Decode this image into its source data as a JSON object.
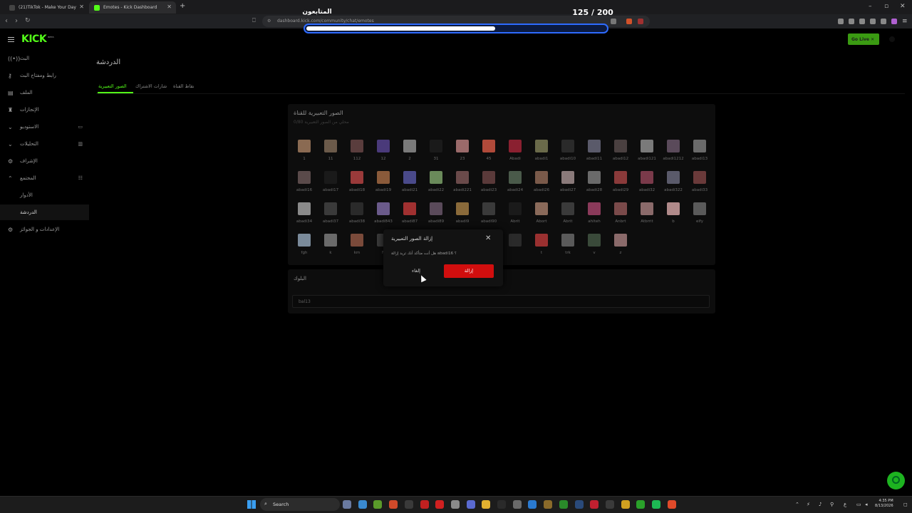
{
  "browser": {
    "tabs": [
      {
        "title": "(21)TikTok - Make Your Day",
        "active": false,
        "favicon_color": "#444444"
      },
      {
        "title": "Emotes - Kick Dashboard",
        "active": true,
        "favicon_color": "#53fc18"
      }
    ],
    "new_tab": "+",
    "url": "dashboard.kick.com/community/chat/emotes",
    "window_controls": [
      "–",
      "▫",
      "✕"
    ]
  },
  "overlay": {
    "title": "المتابعون",
    "count": "125 / 200",
    "progress": 0.625
  },
  "kick": {
    "logo": "KICK",
    "logo_badge": "BETA",
    "go_live": "Go Live",
    "sidebar": [
      {
        "icon": "((•))",
        "label": "البث",
        "active": false
      },
      {
        "icon": "⚷",
        "label": "رابط ومفتاح البث",
        "active": false
      },
      {
        "icon": "▤",
        "label": "الملف",
        "active": false
      },
      {
        "icon": "♜",
        "label": "الإنجازات",
        "active": false
      },
      {
        "icon": "⌄",
        "label": "الاستوديو",
        "active": false,
        "right_icon": "▭"
      },
      {
        "icon": "⌄",
        "label": "التحليلات",
        "active": false,
        "right_icon": "▥"
      },
      {
        "icon": "⚙",
        "label": "الإشراف",
        "active": false
      },
      {
        "icon": "⌃",
        "label": "المجتمع",
        "active": false,
        "right_icon": "☷"
      },
      {
        "icon": "",
        "label": "الأدوار",
        "active": false
      },
      {
        "icon": "",
        "label": "الدردشة",
        "active": true
      },
      {
        "icon": "⚙",
        "label": "الإعدادات و الجوائز",
        "active": false
      }
    ],
    "page_title": "الدردشة",
    "tabs": [
      {
        "label": "الصور التعبيرية",
        "active": true
      },
      {
        "label": "شارات الاشتراك",
        "active": false
      },
      {
        "label": "نقاط القناة",
        "active": false
      }
    ],
    "emotes_panel": {
      "title": "الصور التعبيرية للقناة",
      "count": "محلي من الصور التعبيرية 0/80",
      "emotes": [
        {
          "name": "1",
          "color": "#8a6a52"
        },
        {
          "name": "11",
          "color": "#6b5a4a"
        },
        {
          "name": "112",
          "color": "#5a3d3d"
        },
        {
          "name": "12",
          "color": "#4a3a7a"
        },
        {
          "name": "2",
          "color": "#7a7a7a"
        },
        {
          "name": "31",
          "color": "#1a1a1a"
        },
        {
          "name": "23",
          "color": "#9a6a6a"
        },
        {
          "name": "45",
          "color": "#b04a3a"
        },
        {
          "name": "Abadi",
          "color": "#8a2030"
        },
        {
          "name": "abadi1",
          "color": "#6a6a4a"
        },
        {
          "name": "abadi10",
          "color": "#2a2a2a"
        },
        {
          "name": "abadi11",
          "color": "#5a5a6a"
        },
        {
          "name": "abadi12",
          "color": "#4a4040"
        },
        {
          "name": "abadi121",
          "color": "#7a7a7a"
        },
        {
          "name": "abadi1212",
          "color": "#5a4a5a"
        },
        {
          "name": "abadi13",
          "color": "#6a6a6a"
        },
        {
          "name": "abadi16",
          "color": "#5a4a4a"
        },
        {
          "name": "abadi17",
          "color": "#1a1a1a"
        },
        {
          "name": "abadi18",
          "color": "#9a3a3a"
        },
        {
          "name": "abadi19",
          "color": "#8a5a3a"
        },
        {
          "name": "abadi21",
          "color": "#4a4a8a"
        },
        {
          "name": "abadi22",
          "color": "#6a8a5a"
        },
        {
          "name": "abadi221",
          "color": "#6a4a4a"
        },
        {
          "name": "abadi23",
          "color": "#5a3a3a"
        },
        {
          "name": "abadi24",
          "color": "#4a5a4a"
        },
        {
          "name": "abadi26",
          "color": "#7a5a4a"
        },
        {
          "name": "abadi27",
          "color": "#8a7a7a"
        },
        {
          "name": "abadi28",
          "color": "#6a6a6a"
        },
        {
          "name": "abadi29",
          "color": "#8a3a3a"
        },
        {
          "name": "abadi32",
          "color": "#7a3a4a"
        },
        {
          "name": "abadi322",
          "color": "#5a5a6a"
        },
        {
          "name": "abadi33",
          "color": "#6a3a3a"
        },
        {
          "name": "abadi34",
          "color": "#8a8a8a"
        },
        {
          "name": "abadi37",
          "color": "#3a3a3a"
        },
        {
          "name": "abadi38",
          "color": "#2a2a2a"
        },
        {
          "name": "abadi843",
          "color": "#6a5a8a"
        },
        {
          "name": "abadi87",
          "color": "#a03030"
        },
        {
          "name": "abadi89",
          "color": "#5a4a5a"
        },
        {
          "name": "abadi9",
          "color": "#8a6a3a"
        },
        {
          "name": "abadi90",
          "color": "#3a3a3a"
        },
        {
          "name": "Abrit",
          "color": "#1a1a1a"
        },
        {
          "name": "Abort",
          "color": "#8a6a5a"
        },
        {
          "name": "Abrit",
          "color": "#3a3a3a"
        },
        {
          "name": "ahlteh",
          "color": "#8a3a5a"
        },
        {
          "name": "Anbrt",
          "color": "#7a4a4a"
        },
        {
          "name": "Atbrrit",
          "color": "#8a6a6a"
        },
        {
          "name": "b",
          "color": "#b08a8a"
        },
        {
          "name": "elfy",
          "color": "#5a5a5a"
        },
        {
          "name": "fgh",
          "color": "#7a8a9a"
        },
        {
          "name": "k",
          "color": "#6a6a6a"
        },
        {
          "name": "km",
          "color": "#7a4a3a"
        },
        {
          "name": "N",
          "color": "#3a3a3a"
        },
        {
          "name": "",
          "color": "#2a2a2a"
        },
        {
          "name": "",
          "color": "#2a2a2a"
        },
        {
          "name": "",
          "color": "#2a2a2a"
        },
        {
          "name": "",
          "color": "#2a2a2a"
        },
        {
          "name": "",
          "color": "#2a2a2a"
        },
        {
          "name": "t",
          "color": "#9a3030"
        },
        {
          "name": "trk",
          "color": "#5a5a5a"
        },
        {
          "name": "v",
          "color": "#3a4a3a"
        },
        {
          "name": "z",
          "color": "#8a6a6a"
        }
      ]
    },
    "words_panel": {
      "title": "البلوك",
      "value": "bal13"
    },
    "dialog": {
      "title": "إزالة الصور التعبيرية",
      "message": "هل أنت متأكد أنك تريد إزالة abadi16 ؟",
      "cancel": "إلغاء",
      "confirm": "إزالة"
    }
  },
  "taskbar": {
    "search": "Search",
    "icons": [
      {
        "name": "widgets-icon",
        "color": "#6a7aa0"
      },
      {
        "name": "copilot-icon",
        "color": "#3a8ad0"
      },
      {
        "name": "nvidia-icon",
        "color": "#5a9a2a"
      },
      {
        "name": "brave-icon",
        "color": "#d04a2a"
      },
      {
        "name": "obs-icon",
        "color": "#3a3a3a"
      },
      {
        "name": "app-red-icon",
        "color": "#c02020"
      },
      {
        "name": "youtube-icon",
        "color": "#d02020"
      },
      {
        "name": "settings-icon",
        "color": "#8a8a8a"
      },
      {
        "name": "discord-icon",
        "color": "#5a6ad0"
      },
      {
        "name": "file-explorer-icon",
        "color": "#e0b030"
      },
      {
        "name": "capcut-icon",
        "color": "#2a2a2a"
      },
      {
        "name": "app-icon",
        "color": "#6a6a6a"
      },
      {
        "name": "edge-icon",
        "color": "#2a7ad0"
      },
      {
        "name": "winrar-icon",
        "color": "#8a6a2a"
      },
      {
        "name": "xbox-icon",
        "color": "#2a8a2a"
      },
      {
        "name": "steam-icon",
        "color": "#2a4a7a"
      },
      {
        "name": "app-red2-icon",
        "color": "#c02030"
      },
      {
        "name": "app-grid-icon",
        "color": "#3a3a3a"
      },
      {
        "name": "app-yellow-icon",
        "color": "#d0a020"
      },
      {
        "name": "app-green-icon",
        "color": "#2aa02a"
      },
      {
        "name": "spotify-icon",
        "color": "#1db954"
      },
      {
        "name": "brave2-icon",
        "color": "#e04a2a"
      }
    ],
    "clock_time": "4:35 PM",
    "clock_date": "8/13/2026",
    "lang": "ع"
  }
}
